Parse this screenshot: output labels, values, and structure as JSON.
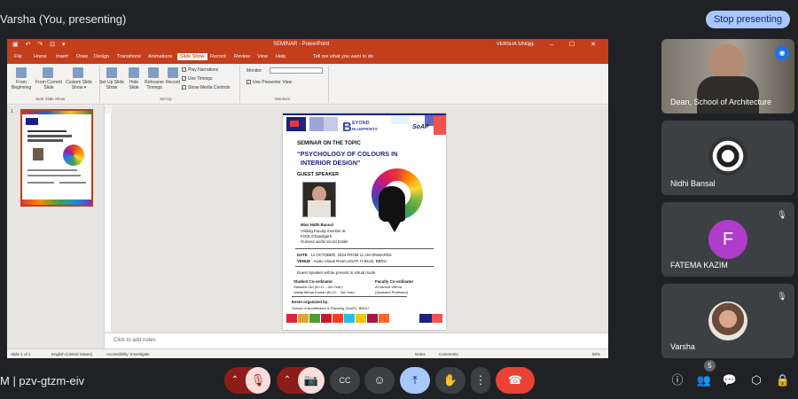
{
  "top": {
    "presenter_text": "Varsha (You, presenting)",
    "stop_button": "Stop presenting"
  },
  "ppt": {
    "quick_access": "▣ ↶ ↷ ⊡ ▾",
    "doc_title": "SEMINAR  -  PowerPoint",
    "user": "VERSHA SINGH",
    "window_controls": "▭ – ☐ ✕",
    "menu": [
      "File",
      "Home",
      "Insert",
      "Draw",
      "Design",
      "Transitions",
      "Animations",
      "Slide Show",
      "Record",
      "Review",
      "View",
      "Help"
    ],
    "active_menu_index": 7,
    "tell_me": "Tell me what you want to do",
    "ribbon": {
      "from_beginning": "From Beginning",
      "from_current": "From Current Slide",
      "custom_show": "Custom Slide Show ▾",
      "group_start": "Start Slide Show",
      "setup_show": "Set Up Slide Show",
      "hide_slide": "Hide Slide",
      "rehearse": "Rehearse Timings",
      "record": "Record",
      "play_narrations": "Play Narrations",
      "use_timings": "Use Timings",
      "show_media_controls": "Show Media Controls",
      "group_setup": "Set Up",
      "monitor_label": "Monitor:",
      "monitor_value": "Automatic",
      "presenter_view": "Use Presenter View",
      "group_monitors": "Monitors"
    },
    "slide_number": "1",
    "notes_placeholder": "Click to add notes",
    "status": {
      "slide_of": "Slide 1 of 1",
      "language": "English (United States)",
      "accessibility": "Accessibility: Investigate",
      "notes": "Notes",
      "comments": "Comments",
      "zoom": "50%"
    }
  },
  "slide": {
    "brand": "BEYOND BLUEPRINTS",
    "brand_b": "B",
    "brand_eyond": "EYOND",
    "brand_blueprints": "BLUEPRINTS",
    "soap": "SoAP",
    "seminar_on": "SEMINAR ON THE TOPIC",
    "topic_1": "“PSYCHOLOGY OF COLOURS IN",
    "topic_2": "INTERIOR  DESIGN”",
    "guest_speaker": "GUEST SPEAKER",
    "speaker_name": "Miss Nidhi Bansal",
    "speaker_l1": "Visiting Faculty member at",
    "speaker_l2": "FOOL/Chandigarh",
    "speaker_l3": "Guiness world record holder",
    "date_label": "DATE",
    "date_value": ": 14 OCTOBER, 2024 FROM 11 AM ONWARDS",
    "venue_label": "VENUE",
    "venue_value": ": Audio Visual Room,SOAP, H Block, BBDU",
    "virtual_note": "Guest Speaker will be present in virtual mode",
    "student_coord": "Student Co-ordinator",
    "student_1": "Sanskriti Giri (B.I.D. - 3rd Year)",
    "student_2": "Vaidai Mehal Kumari (B.I.D. - 3rd Year)",
    "faculty_coord": "Faculty Co-ordinator",
    "faculty_1": "Ar.Varsha Verma",
    "faculty_2": "(Assistant Professor)",
    "organized_by": "Event organized by:",
    "organizer": "School of Architecture & Planning (SoAP), BBDU"
  },
  "participants": [
    {
      "name": "Dean, School of Architecture",
      "kind": "video"
    },
    {
      "name": "Nidhi Bansal",
      "kind": "photo"
    },
    {
      "name": "FATEMA KAZIM",
      "kind": "letter",
      "letter": "F",
      "color": "#b03dc9"
    },
    {
      "name": "Varsha",
      "kind": "photo"
    }
  ],
  "bottom": {
    "meeting_info": "M  |  pzv-gtzm-eiv",
    "people_count": "5"
  },
  "colors": {
    "accent": "#a8c7fa",
    "ppt_red": "#c43e1c",
    "end_call": "#ea4335",
    "muted_bg": "#f9dedc",
    "tile_bg": "#3c4043"
  },
  "icons": {
    "chevron": "⌃",
    "mic_off": "🎙",
    "cam_off": "📷",
    "captions": "CC",
    "emoji": "☺",
    "present": "⤒",
    "hand": "✋",
    "more": "⋮",
    "end_call": "☎",
    "info": "ⓘ",
    "people": "👥",
    "chat": "💬",
    "activities": "⬡",
    "host_controls": "🔒",
    "speaking": "◉"
  }
}
